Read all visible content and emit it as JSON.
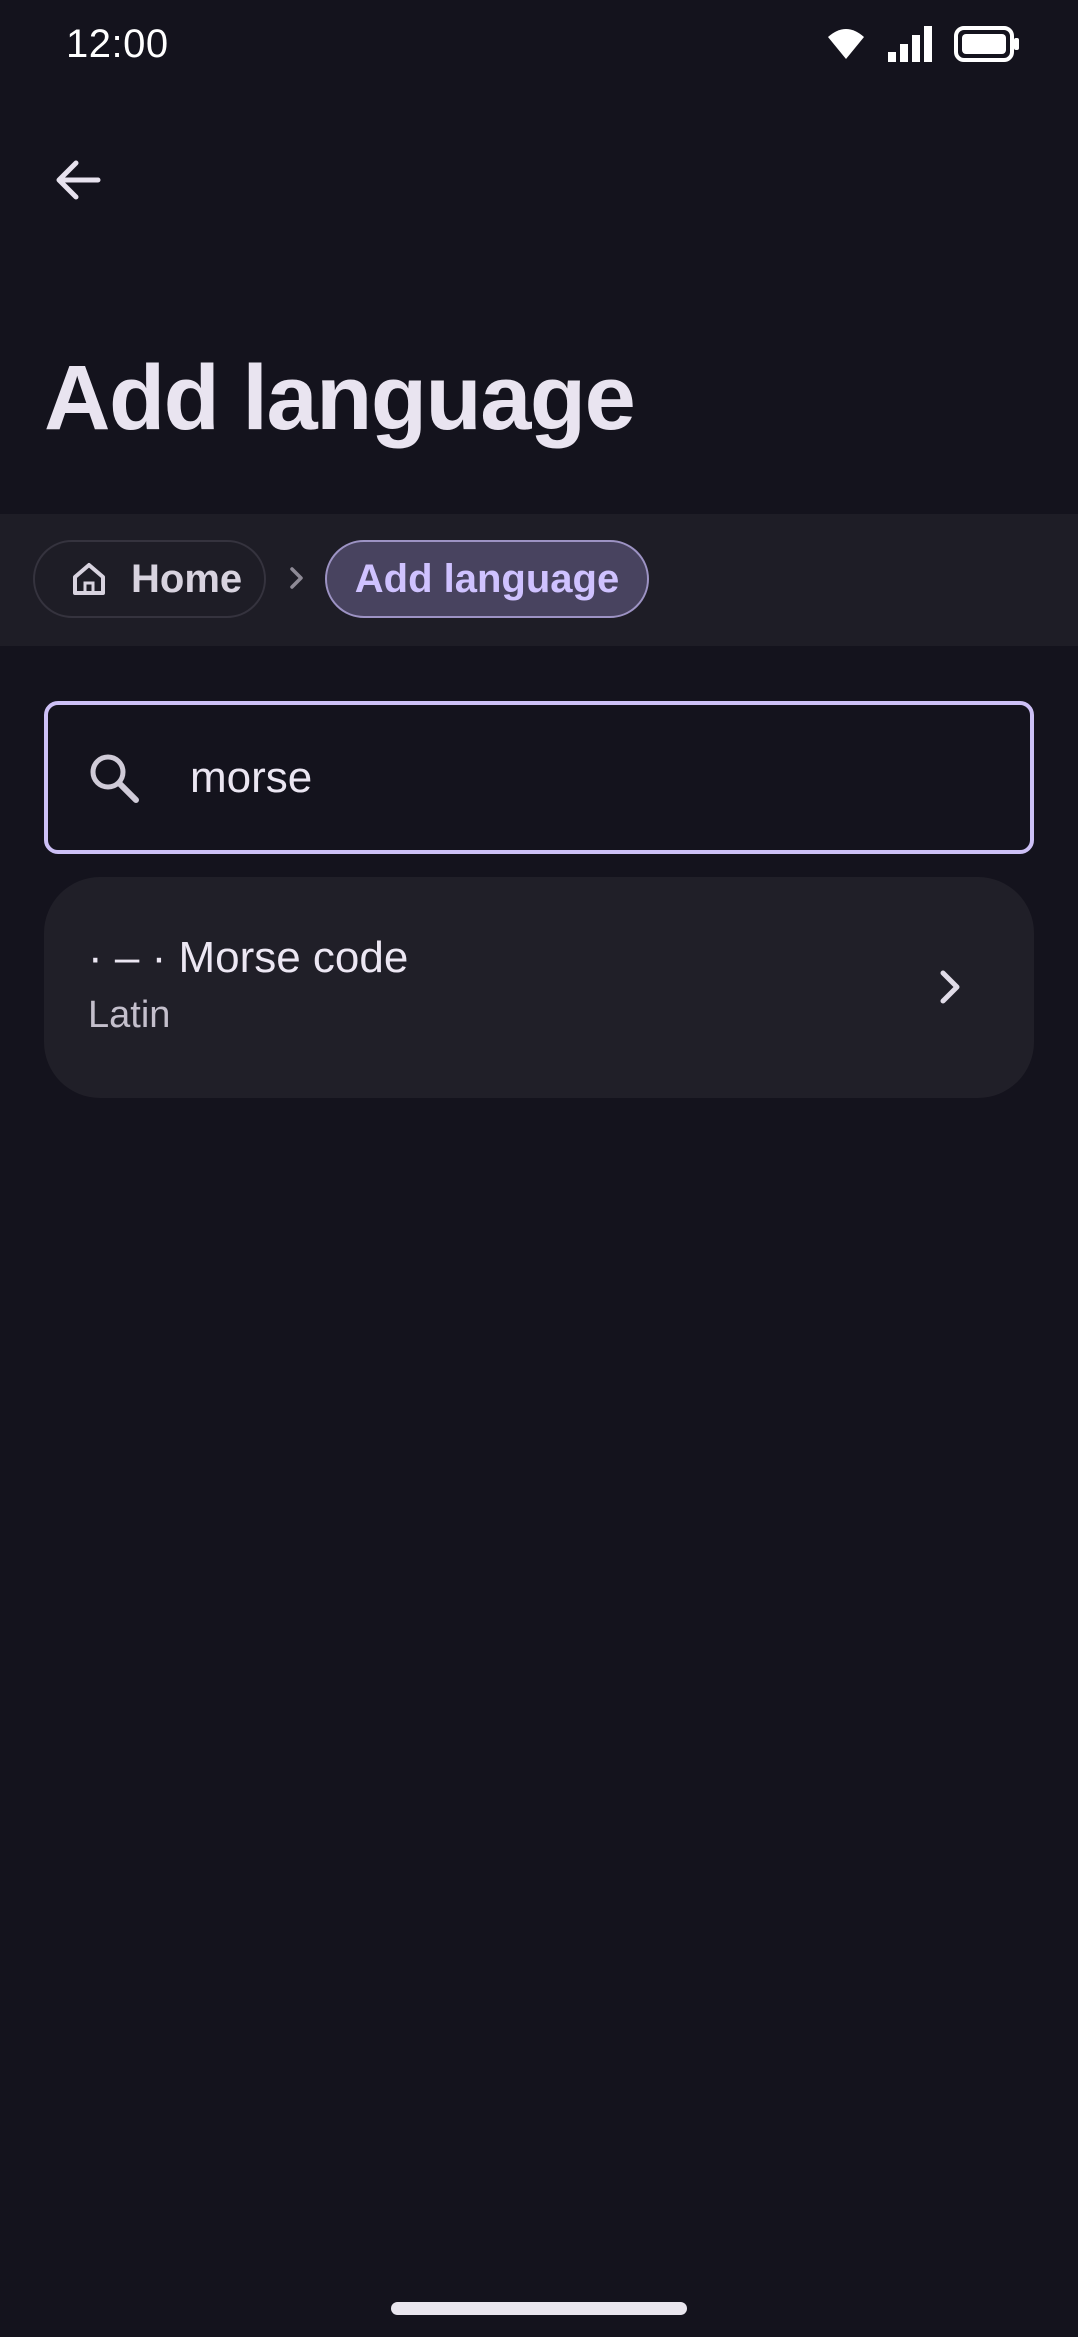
{
  "status_bar": {
    "time": "12:00",
    "icons": [
      "wifi-icon",
      "signal-icon",
      "battery-icon"
    ]
  },
  "header": {
    "back_icon": "arrow-left-icon",
    "title": "Add language"
  },
  "breadcrumb": {
    "items": [
      {
        "label": "Home",
        "icon": "home-icon"
      },
      {
        "label": "Add language",
        "active": true
      }
    ],
    "separator_icon": "chevron-right-icon"
  },
  "search": {
    "value": "morse",
    "icon": "search-icon"
  },
  "results": [
    {
      "title": "· – · Morse code",
      "subtitle": "Latin",
      "trailing_icon": "chevron-right-icon"
    }
  ],
  "colors": {
    "background": "#14131d",
    "surface": "#201f28",
    "accent": "#cdc0f6",
    "active_chip_bg": "#48435f",
    "active_chip_text": "#cfc2ff"
  }
}
